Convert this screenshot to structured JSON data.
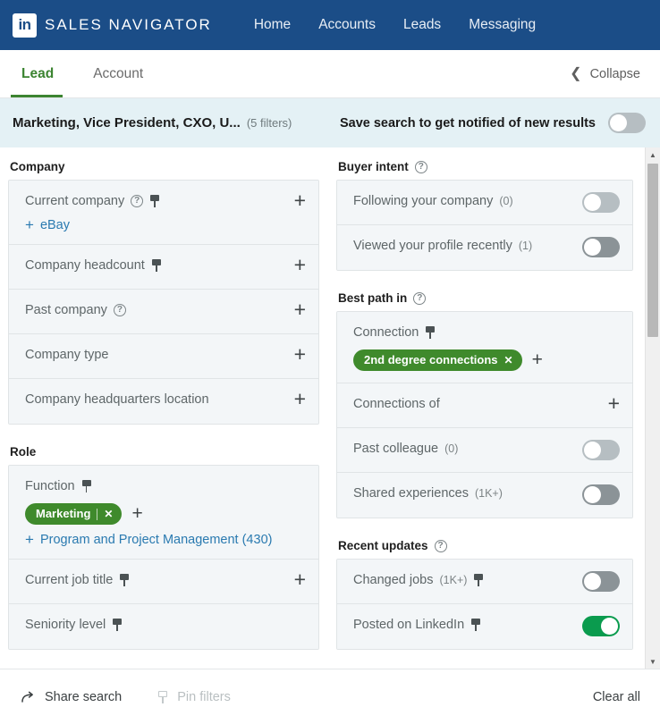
{
  "header": {
    "logo_text": "in",
    "brand": "SALES NAVIGATOR",
    "nav": [
      {
        "label": "Home"
      },
      {
        "label": "Accounts"
      },
      {
        "label": "Leads"
      },
      {
        "label": "Messaging"
      }
    ]
  },
  "tabs": {
    "items": [
      {
        "label": "Lead",
        "active": true
      },
      {
        "label": "Account",
        "active": false
      }
    ],
    "collapse_label": "Collapse",
    "collapse_icon": "chevron-left-icon",
    "active_color": "#3c8431"
  },
  "saved_search": {
    "title": "Marketing, Vice President, CXO, U...",
    "filter_count": "(5 filters)",
    "toggle_label": "Save search to get notified of new results",
    "toggle_state": "off"
  },
  "left_column": {
    "groups": [
      {
        "title": "Company",
        "rows": [
          {
            "label": "Current company",
            "help": true,
            "pin": true,
            "plus": true,
            "suggestion": {
              "label": "eBay",
              "icon": "plus-icon"
            }
          },
          {
            "label": "Company headcount",
            "help": false,
            "pin": true,
            "plus": true
          },
          {
            "label": "Past company",
            "help": true,
            "pin": false,
            "plus": true
          },
          {
            "label": "Company type",
            "help": false,
            "pin": false,
            "plus": true
          },
          {
            "label": "Company headquarters location",
            "help": false,
            "pin": false,
            "plus": true
          }
        ]
      },
      {
        "title": "Role",
        "rows": [
          {
            "label": "Function",
            "help": false,
            "pin": true,
            "plus": false,
            "pill": {
              "label": "Marketing",
              "close_icon": "close-icon"
            },
            "pill_add_icon": "plus-icon",
            "suggestion": {
              "label": "Program and Project Management (430)",
              "icon": "plus-icon"
            }
          },
          {
            "label": "Current job title",
            "help": false,
            "pin": true,
            "plus": true
          },
          {
            "label": "Seniority level",
            "help": false,
            "pin": true,
            "plus": false
          }
        ]
      }
    ]
  },
  "right_column": {
    "groups": [
      {
        "title": "Buyer intent",
        "help": true,
        "rows": [
          {
            "label": "Following your company",
            "count": "(0)",
            "toggle": "off-light"
          },
          {
            "label": "Viewed your profile recently",
            "count": "(1)",
            "toggle": "off-dark"
          }
        ]
      },
      {
        "title": "Best path in",
        "help": true,
        "rows": [
          {
            "label": "Connection",
            "pin": true,
            "pill": {
              "label": "2nd degree connections",
              "close_icon": "close-icon"
            },
            "pill_add_icon": "plus-icon"
          },
          {
            "label": "Connections of",
            "plus": true
          },
          {
            "label": "Past colleague",
            "count": "(0)",
            "toggle": "off-light"
          },
          {
            "label": "Shared experiences",
            "count": "(1K+)",
            "toggle": "off-dark"
          }
        ]
      },
      {
        "title": "Recent updates",
        "help": true,
        "rows": [
          {
            "label": "Changed jobs",
            "count": "(1K+)",
            "pin": true,
            "toggle": "off-dark"
          },
          {
            "label": "Posted on LinkedIn",
            "pin": true,
            "toggle": "on"
          }
        ]
      }
    ]
  },
  "scrollbar": {
    "up_arrow": "▲",
    "down_arrow": "▼"
  },
  "bottom_bar": {
    "share_label": "Share search",
    "pin_label": "Pin filters",
    "clear_label": "Clear all"
  },
  "colors": {
    "nav_blue": "#1b4d87",
    "accent_green": "#3c8431",
    "pill_green": "#3f8a2c",
    "toggle_on_green": "#0a9b4e",
    "link_blue": "#2a7ab0",
    "strip_blue": "#e4f1f5",
    "row_gray": "#f3f6f8"
  }
}
